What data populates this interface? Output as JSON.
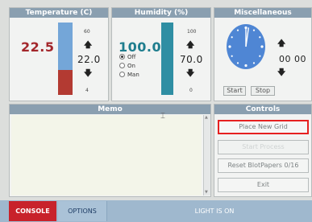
{
  "temperature": {
    "title": "Temperature (C)",
    "current": "22.5",
    "scale_max": "60",
    "scale_min": "4",
    "setpoint": "22.0",
    "fill_fraction": 0.35,
    "colors": {
      "value": "#a3262b",
      "bar": "#b33a32",
      "track": "#74a6d8"
    }
  },
  "humidity": {
    "title": "Humidity (%)",
    "current": "100.0",
    "scale_max": "100",
    "scale_min": "0",
    "setpoint": "70.0",
    "fill_fraction": 1.0,
    "colors": {
      "value": "#1f7d8e",
      "bar": "#2f8ea3"
    },
    "modes": [
      {
        "label": "Off",
        "selected": true
      },
      {
        "label": "On",
        "selected": false
      },
      {
        "label": "Man",
        "selected": false
      }
    ]
  },
  "misc": {
    "title": "Miscellaneous",
    "timer": "00 00",
    "start_label": "Start",
    "stop_label": "Stop",
    "clock_color": "#4f86d4"
  },
  "memo": {
    "title": "Memo",
    "text": ""
  },
  "controls": {
    "title": "Controls",
    "buttons": [
      {
        "label": "Place New Grid",
        "highlighted": true
      },
      {
        "label": "Start Process",
        "disabled": true
      },
      {
        "label": "Reset BlotPapers 0/16"
      },
      {
        "label": "Exit"
      }
    ],
    "highlight_color": "#e62020"
  },
  "bottom": {
    "console_label": "CONSOLE",
    "options_label": "OPTIONS",
    "status": "LIGHT IS ON",
    "console_color": "#c8222b"
  }
}
